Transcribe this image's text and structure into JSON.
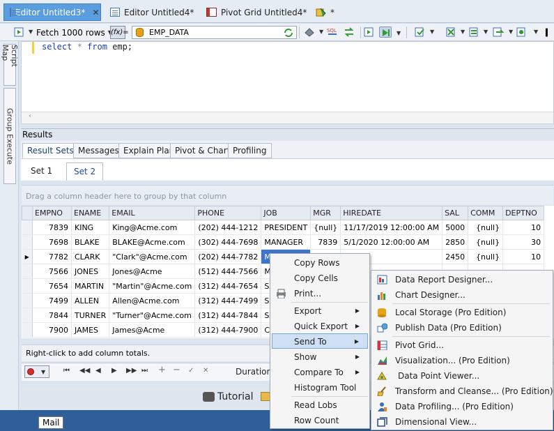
{
  "doc_tabs": [
    {
      "label": "Editor Untitled3*",
      "close": "✕",
      "active": true
    },
    {
      "label": "Editor Untitled4*",
      "active": false
    },
    {
      "label": "Pivot Grid Untitled4*",
      "active": false
    },
    {
      "label": "*",
      "active": false
    }
  ],
  "toolbar": {
    "fetch_label": "Fetch 1000 rows",
    "fx_label": "(fx)=",
    "connection": "EMP_DATA"
  },
  "left_tabs": [
    "Script Map",
    "Group Execute"
  ],
  "editor": {
    "keyword_select": "select",
    "star": "*",
    "keyword_from": "from",
    "table": "emp;"
  },
  "results": {
    "header": "Results",
    "tabs": [
      "Result Sets",
      "Messages",
      "Explain Plan",
      "Pivot & Chart",
      "Profiling"
    ],
    "sets": [
      "Set 1",
      "Set 2"
    ],
    "group_hint": "Drag a column header here to group by that column",
    "columns": [
      "EMPNO",
      "ENAME",
      "EMAIL",
      "PHONE",
      "JOB",
      "MGR",
      "HIREDATE",
      "SAL",
      "COMM",
      "DEPTNO"
    ],
    "rows": [
      [
        "7839",
        "KING",
        "King@Acme.com",
        "(202) 444-1212",
        "PRESIDENT",
        "{null}",
        "11/17/2019 12:00:00 AM",
        "5000",
        "{null}",
        "10"
      ],
      [
        "7698",
        "BLAKE",
        "BLAKE@Acme.com",
        "(302) 444-7698",
        "MANAGER",
        "7839",
        "5/1/2020 12:00:00 AM",
        "2850",
        "{null}",
        "30"
      ],
      [
        "7782",
        "CLARK",
        "\"Clark\"@Acme.com",
        "(202) 444-7782",
        "MANAG",
        "",
        "00 AM",
        "2450",
        "{null}",
        "10"
      ],
      [
        "7566",
        "JONES",
        "Jones@Acme",
        "(512) 444-7566",
        "MANAG",
        "",
        "",
        "",
        "",
        ""
      ],
      [
        "7654",
        "MARTIN",
        "\"Martin\"@Acme.com",
        "(312) 444-7654",
        "SALESM",
        "",
        "",
        "",
        "",
        ""
      ],
      [
        "7499",
        "ALLEN",
        "Allen@Acme.com",
        "(312) 444-7499",
        "SALESM",
        "",
        "",
        "",
        "",
        ""
      ],
      [
        "7844",
        "TURNER",
        "\"Turner\"@Acme.com",
        "(312) 444-7844",
        "SALESM",
        "",
        "",
        "",
        "",
        ""
      ],
      [
        "7900",
        "JAMES",
        "James@Acme",
        "(312) 444-7900",
        "CLERK",
        "",
        "",
        "",
        "",
        ""
      ]
    ],
    "footer_hint": "Right-click to add column totals.",
    "duration_label": "Duration:"
  },
  "bottom": {
    "tutorial": "Tutorial",
    "mail_tooltip": "Mail"
  },
  "context_menu": [
    {
      "label": "Copy Rows"
    },
    {
      "label": "Copy Cells"
    },
    {
      "label": "Print..."
    },
    {
      "label": "Export",
      "submenu": true
    },
    {
      "label": "Quick Export",
      "submenu": true
    },
    {
      "label": "Send To",
      "submenu": true,
      "highlighted": true
    },
    {
      "label": "Show",
      "submenu": true
    },
    {
      "label": "Compare To",
      "submenu": true
    },
    {
      "label": "Histogram Tool"
    },
    {
      "label": "Read Lobs"
    },
    {
      "label": "Row Count"
    }
  ],
  "send_to_menu": [
    {
      "label": "Data Report Designer..."
    },
    {
      "label": "Chart Designer..."
    },
    {
      "label": "Local Storage (Pro Edition)"
    },
    {
      "label": "Publish Data (Pro Edition)"
    },
    {
      "label": "Pivot Grid..."
    },
    {
      "label": "Visualization... (Pro Edition)"
    },
    {
      "label": "Data Point Viewer..."
    },
    {
      "label": "Transform and Cleanse... (Pro Edition)"
    },
    {
      "label": "Data Profiling... (Pro Edition)"
    },
    {
      "label": "Dimensional View..."
    }
  ]
}
